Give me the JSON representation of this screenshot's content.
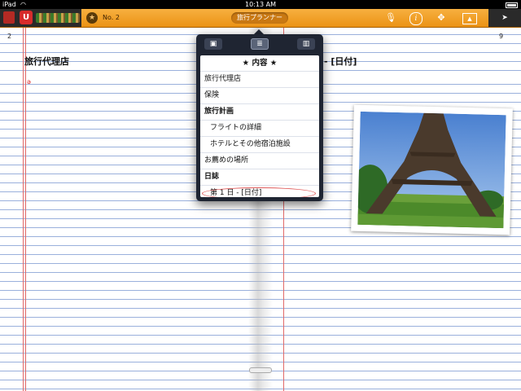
{
  "status_bar": {
    "device": "iPad",
    "time": "10:13 AM"
  },
  "toolbar": {
    "notebook_name": "No. 2",
    "title": "旅行プランナー",
    "pen_label": "U",
    "icons": [
      "app-icon",
      "pen-icon",
      "star-icon",
      "mic-icon",
      "info-icon",
      "drag-icon",
      "image-icon",
      "next-icon"
    ]
  },
  "pages": {
    "left": {
      "number": "2",
      "heading": "旅行代理店"
    },
    "right": {
      "number": "9",
      "heading": "- [日付]"
    }
  },
  "popover": {
    "title": "★ 内容 ★",
    "items": [
      {
        "label": "旅行代理店"
      },
      {
        "label": "保険"
      },
      {
        "label": "旅行計画"
      },
      {
        "label": "フライトの詳細"
      },
      {
        "label": "ホテルとその他宿泊施設"
      },
      {
        "label": "お薦めの場所"
      },
      {
        "label": "日誌"
      },
      {
        "label": "第 1 日 - [日付]"
      }
    ]
  },
  "colors": {
    "toolbar_orange": "#f0a030",
    "margin_red": "#e06a6a",
    "rule_blue": "#9ab0dc",
    "popover_dark": "#1f2532"
  }
}
